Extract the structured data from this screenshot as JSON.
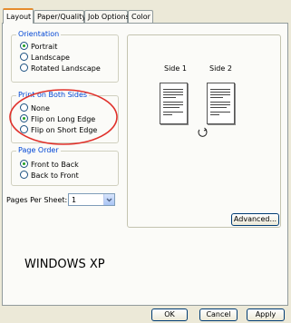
{
  "tabs": [
    {
      "label": "Layout",
      "active": true
    },
    {
      "label": "Paper/Quality",
      "active": false
    },
    {
      "label": "Job Options",
      "active": false
    },
    {
      "label": "Color",
      "active": false
    }
  ],
  "orientation": {
    "title": "Orientation",
    "options": [
      {
        "label": "Portrait",
        "selected": true
      },
      {
        "label": "Landscape",
        "selected": false
      },
      {
        "label": "Rotated Landscape",
        "selected": false
      }
    ]
  },
  "duplex": {
    "title": "Print on Both Sides",
    "options": [
      {
        "label": "None",
        "selected": false
      },
      {
        "label": "Flip on Long Edge",
        "selected": true
      },
      {
        "label": "Flip on Short Edge",
        "selected": false
      }
    ],
    "highlight_color": "#e0302a"
  },
  "page_order": {
    "title": "Page Order",
    "options": [
      {
        "label": "Front to Back",
        "selected": true
      },
      {
        "label": "Back to Front",
        "selected": false
      }
    ]
  },
  "pages_per_sheet": {
    "label": "Pages Per Sheet:",
    "value": "1"
  },
  "preview": {
    "side1": "Side 1",
    "side2": "Side 2",
    "flip_icon": "rotate-icon"
  },
  "buttons": {
    "advanced": "Advanced...",
    "ok": "OK",
    "cancel": "Cancel",
    "apply": "Apply"
  },
  "caption": "WINDOWS XP",
  "colors": {
    "accent": "#0046d5",
    "tab_highlight": "#e68b2c",
    "dialog_bg": "#ece9d8"
  }
}
